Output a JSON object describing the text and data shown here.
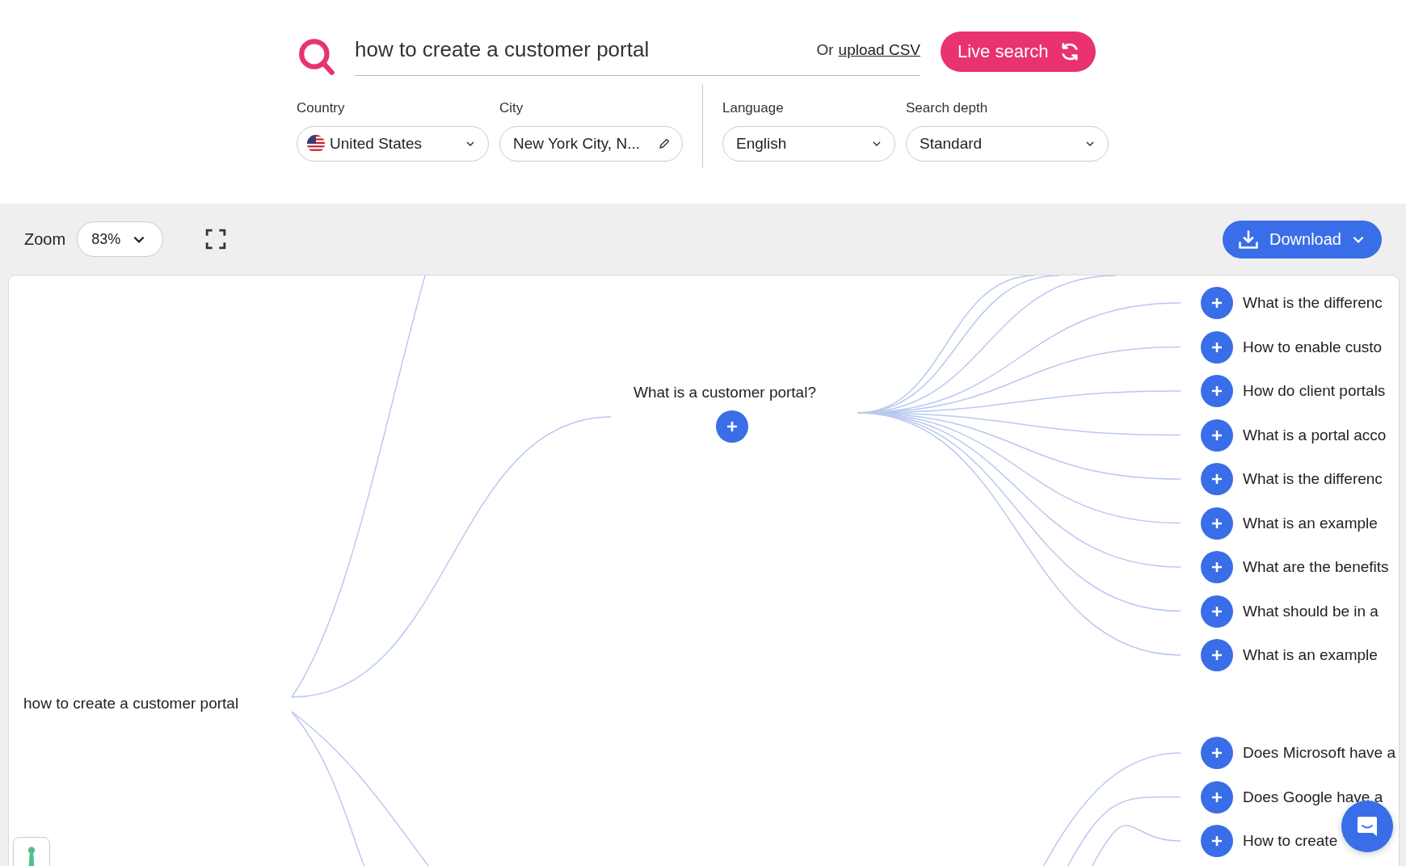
{
  "search": {
    "query": "how to create a customer portal",
    "or_text": "Or",
    "upload_link": "upload CSV",
    "button": "Live search"
  },
  "filters": [
    {
      "label": "Country",
      "value": "United States",
      "kind": "country"
    },
    {
      "label": "City",
      "value": "New York City, N...",
      "kind": "text"
    },
    {
      "label": "Language",
      "value": "English",
      "kind": "select"
    },
    {
      "label": "Search depth",
      "value": "Standard",
      "kind": "select"
    }
  ],
  "toolbar": {
    "zoom_label": "Zoom",
    "zoom_value": "83%",
    "download": "Download"
  },
  "map": {
    "root": "how to create a customer portal",
    "branch": "What is a customer portal?",
    "groups": [
      {
        "questions": [
          "What is the differenc",
          "How to enable custo",
          "How do client portals",
          "What is a portal acco",
          "What is the differenc",
          "What is an example",
          "What are the benefits",
          "What should be in a",
          "What is an example"
        ]
      },
      {
        "questions": [
          "Does Microsoft have a",
          "Does Google have a",
          "How to create"
        ]
      }
    ]
  }
}
